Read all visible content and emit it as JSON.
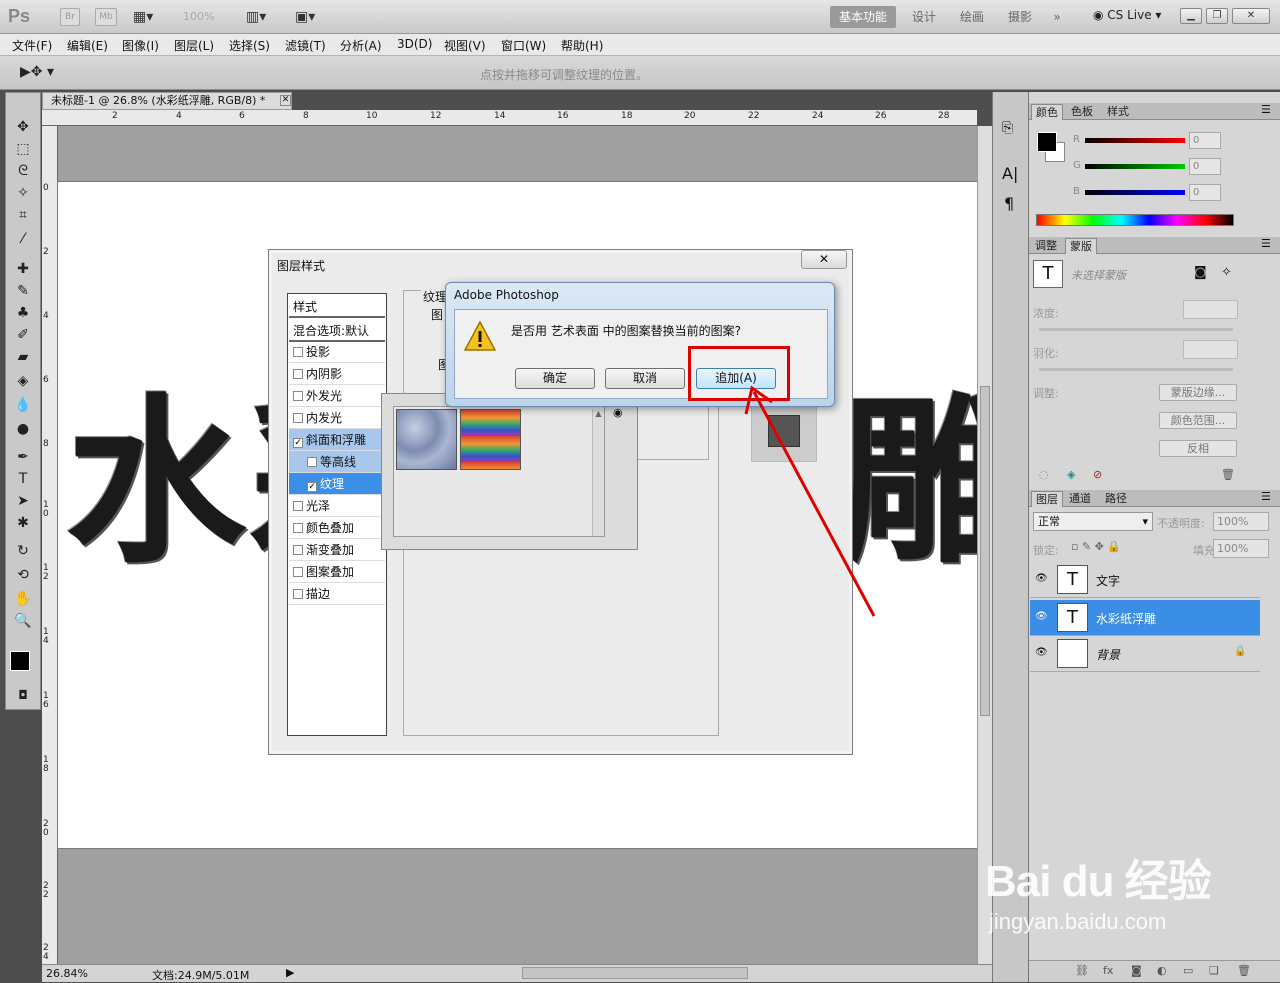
{
  "app": {
    "logo": "Ps",
    "bridge": "Br",
    "minibridge": "Mb",
    "zoom": "100%",
    "cs_live": "CS Live ▾"
  },
  "workspaces": [
    "基本功能",
    "设计",
    "绘画",
    "摄影",
    "»"
  ],
  "window_controls": [
    "▁",
    "❐",
    "✕"
  ],
  "menu": [
    "文件(F)",
    "编辑(E)",
    "图像(I)",
    "图层(L)",
    "选择(S)",
    "滤镜(T)",
    "分析(A)",
    "3D(D)",
    "视图(V)",
    "窗口(W)",
    "帮助(H)"
  ],
  "options_hint": "点按并拖移可调整纹理的位置。",
  "document": {
    "tab_title": "未标题-1 @ 26.8% (水彩纸浮雕, RGB/8) *",
    "text_left": "水",
    "text_mid": "彩",
    "text_right": "雕",
    "h_ruler": [
      "2",
      "4",
      "6",
      "8",
      "10",
      "12",
      "14",
      "16",
      "18",
      "20",
      "22",
      "24",
      "26",
      "28"
    ],
    "v_ruler": [
      "0",
      "2",
      "4",
      "6",
      "8",
      "1 0",
      "1 2",
      "1 4",
      "1 6",
      "1 8",
      "2 0",
      "2 2",
      "2 4"
    ]
  },
  "status": {
    "zoom": "26.84%",
    "doc": "文档:24.9M/5.01M"
  },
  "layer_style_dialog": {
    "title": "图层样式",
    "section_texture": "纹理",
    "section_pattern": "图",
    "pattern_label": "图",
    "styles_header": "样式",
    "blend": "混合选项:默认",
    "items": [
      {
        "label": "投影",
        "checked": false
      },
      {
        "label": "内阴影",
        "checked": false
      },
      {
        "label": "外发光",
        "checked": false
      },
      {
        "label": "内发光",
        "checked": false
      },
      {
        "label": "斜面和浮雕",
        "checked": true
      },
      {
        "label": "等高线",
        "checked": false
      },
      {
        "label": "纹理",
        "checked": true
      },
      {
        "label": "光泽",
        "checked": false
      },
      {
        "label": "颜色叠加",
        "checked": false
      },
      {
        "label": "渐变叠加",
        "checked": false
      },
      {
        "label": "图案叠加",
        "checked": false
      },
      {
        "label": "描边",
        "checked": false
      }
    ]
  },
  "alert": {
    "title": "Adobe Photoshop",
    "message": "是否用 艺术表面 中的图案替换当前的图案?",
    "ok": "确定",
    "cancel": "取消",
    "append": "追加(A)"
  },
  "color_panel": {
    "tabs": [
      "颜色",
      "色板",
      "样式"
    ],
    "channels": [
      "R",
      "G",
      "B"
    ],
    "values": [
      "0",
      "0",
      "0"
    ],
    "accent": "#e00000"
  },
  "masks_panel": {
    "tabs": [
      "调整",
      "蒙版"
    ],
    "no_mask": "未选择蒙版",
    "density": "浓度:",
    "feather": "羽化:",
    "adjust": "调整:",
    "btn_edge": "蒙版边缘...",
    "btn_color": "颜色范围...",
    "btn_invert": "反相"
  },
  "layers_panel": {
    "tabs": [
      "图层",
      "通道",
      "路径"
    ],
    "blend_mode": "正常",
    "opacity_label": "不透明度:",
    "opacity": "100%",
    "lock_label": "锁定:",
    "fill_label": "填充:",
    "fill": "100%",
    "layers": [
      {
        "name": "文字",
        "thumb": "T",
        "selected": false
      },
      {
        "name": "水彩纸浮雕",
        "thumb": "T",
        "selected": true
      },
      {
        "name": "背景",
        "thumb": "",
        "selected": false
      }
    ]
  },
  "watermark": {
    "brand": "Bai du 经验",
    "url": "jingyan.baidu.com"
  }
}
